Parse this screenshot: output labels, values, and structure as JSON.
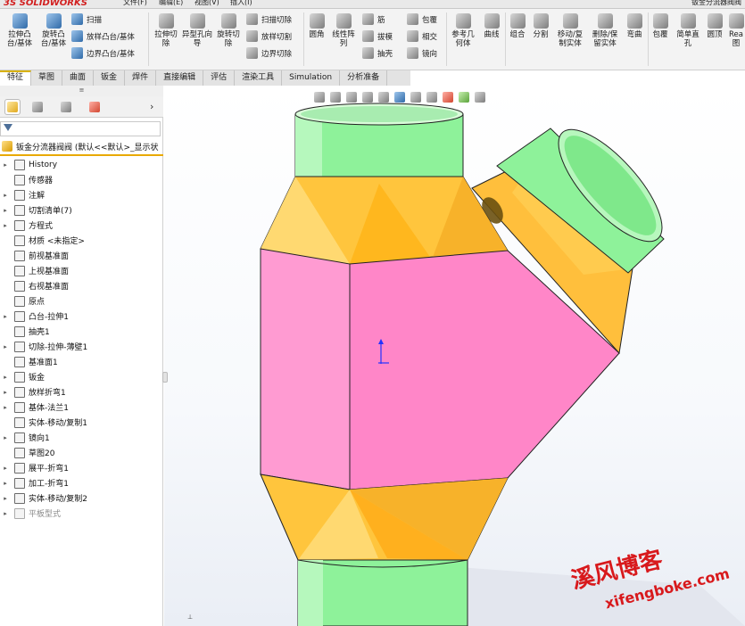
{
  "titlebar": {
    "logo": "SOLIDWORKS",
    "logo_prefix": "3S",
    "menus": [
      "文件(F)",
      "编辑(E)",
      "视图(V)",
      "插入(I)"
    ],
    "document_title": "钣金分流器阀阀"
  },
  "ribbon": {
    "extrude_boss": "拉伸凸台/基体",
    "revolve_boss": "旋转凸台/基体",
    "sweep": "扫描",
    "loft": "放样凸台/基体",
    "boundary_boss": "边界凸台/基体",
    "extrude_cut": "拉伸切除",
    "hole_wizard": "异型孔向导",
    "revolve_cut": "旋转切除",
    "sweep_cut": "扫描切除",
    "loft_cut": "放样切割",
    "boundary_cut": "边界切除",
    "fillet": "圆角",
    "linear_pattern": "线性阵列",
    "rib": "筋",
    "draft": "拔模",
    "shell": "抽壳",
    "wrap": "包覆",
    "intersect": "相交",
    "mirror": "镜向",
    "ref_geometry": "参考几何体",
    "curves": "曲线",
    "combine": "组合",
    "split": "分割",
    "move_copy": "移动/复制实体",
    "delete_keep": "删除/保留实体",
    "flex": "弯曲",
    "wrap2": "包覆",
    "simple_hole": "简单直孔",
    "dome": "圆顶",
    "rea_cut": "Rea",
    "rea_cut2": "图"
  },
  "tabs": [
    "特征",
    "草图",
    "曲面",
    "钣金",
    "焊件",
    "直接编辑",
    "评估",
    "渲染工具",
    "Simulation",
    "分析准备"
  ],
  "panel": {
    "grip": "≡",
    "root": "钣金分流器阀阀 (默认<<默认>_显示状",
    "nodes": [
      {
        "label": "History",
        "exp": "▸",
        "dim": false
      },
      {
        "label": "传感器",
        "exp": "",
        "dim": false
      },
      {
        "label": "注解",
        "exp": "▸",
        "dim": false
      },
      {
        "label": "切割清单(7)",
        "exp": "▸",
        "dim": false
      },
      {
        "label": "方程式",
        "exp": "▸",
        "dim": false
      },
      {
        "label": "材质 <未指定>",
        "exp": "",
        "dim": false
      },
      {
        "label": "前视基准面",
        "exp": "",
        "dim": false
      },
      {
        "label": "上视基准面",
        "exp": "",
        "dim": false
      },
      {
        "label": "右视基准面",
        "exp": "",
        "dim": false
      },
      {
        "label": "原点",
        "exp": "",
        "dim": false
      },
      {
        "label": "凸台-拉伸1",
        "exp": "▸",
        "dim": false
      },
      {
        "label": "抽壳1",
        "exp": "",
        "dim": false
      },
      {
        "label": "切除-拉伸-薄壁1",
        "exp": "▸",
        "dim": false
      },
      {
        "label": "基准面1",
        "exp": "",
        "dim": false
      },
      {
        "label": "钣金",
        "exp": "▸",
        "dim": false
      },
      {
        "label": "放样折弯1",
        "exp": "▸",
        "dim": false
      },
      {
        "label": "基体-法兰1",
        "exp": "▸",
        "dim": false
      },
      {
        "label": "实体-移动/复制1",
        "exp": "",
        "dim": false
      },
      {
        "label": "镜向1",
        "exp": "▸",
        "dim": false
      },
      {
        "label": "草图20",
        "exp": "",
        "dim": false
      },
      {
        "label": "展平-折弯1",
        "exp": "▸",
        "dim": false
      },
      {
        "label": "加工-折弯1",
        "exp": "▸",
        "dim": false
      },
      {
        "label": "实体-移动/复制2",
        "exp": "▸",
        "dim": false
      },
      {
        "label": "平板型式",
        "exp": "▸",
        "dim": true
      }
    ]
  },
  "watermark": {
    "cn": "溪风博客",
    "url": "xifengboke.com"
  },
  "colors": {
    "green": "#7ff08a",
    "yellow": "#ffc23a",
    "pink": "#ff86c8",
    "accent": "#e9a900"
  }
}
